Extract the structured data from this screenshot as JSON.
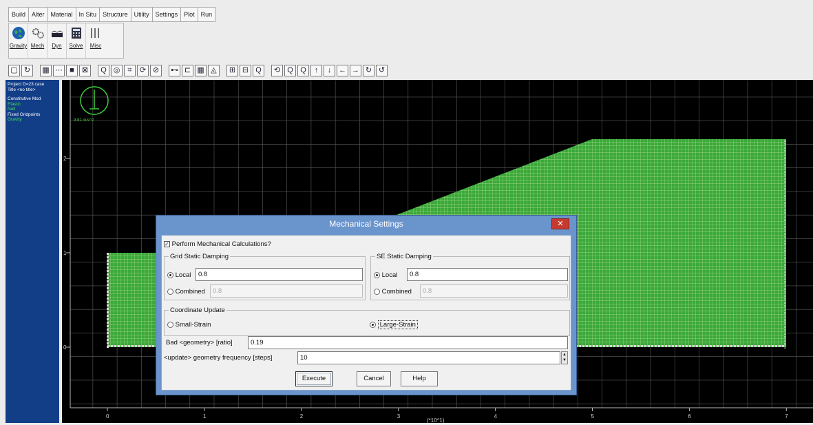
{
  "menu": [
    "Build",
    "Alter",
    "Material",
    "In Situ",
    "Structure",
    "Utility",
    "Settings",
    "Plot",
    "Run"
  ],
  "tools": [
    {
      "label": "Gravity",
      "icon": "globe-icon"
    },
    {
      "label": "Mech",
      "icon": "gears-icon"
    },
    {
      "label": "Dyn",
      "icon": "dynamic-wave-icon"
    },
    {
      "label": "Solve",
      "icon": "calculator-icon"
    },
    {
      "label": "Misc",
      "icon": "misc-bars-icon"
    }
  ],
  "toolbar_icons": [
    "▢",
    "↻",
    "▦",
    "⋯",
    "■",
    "⊠",
    "Q",
    "◎",
    "⌗",
    "⟳",
    "⊘",
    "⊷",
    "⊏",
    "▦",
    "◬",
    "⊞",
    "⊟",
    "Q",
    "⟲",
    "Q",
    "Q",
    "↑",
    "↓",
    "←",
    "→",
    "↻",
    "↺"
  ],
  "info_panel": {
    "lines": [
      "Project D=23 case",
      "Title <no title>"
    ],
    "model_label": "Constitutive Mod",
    "model_status": "Elastic",
    "null_label": "Null",
    "fixed_label": "Fixed Gridpoints",
    "fixed_status": "Gravity"
  },
  "plot": {
    "gravity_label": "9.81 m/s^2",
    "y_ticks": [
      "2",
      "1",
      "0"
    ],
    "x_ticks": [
      "0",
      "1",
      "2",
      "3",
      "4",
      "5",
      "6",
      "7"
    ],
    "xlabel": "(*10^1)",
    "ylabel_marker": "0",
    "colors": {
      "mesh_fill": "#3aa83a",
      "mesh_line": "#93d87c",
      "grid": "#5c5c5c",
      "axes": "#b9b9b9",
      "fixed": "#ffffff"
    }
  },
  "dialog": {
    "title": "Mechanical Settings",
    "close": "✕",
    "perform_label": "Perform Mechanical Calculations?",
    "grid_group": "Grid Static Damping",
    "grid_local_label": "Local",
    "grid_local_value": "0.8",
    "grid_combined_label": "Combined",
    "grid_combined_value": "0.8",
    "se_group": "SE Static Damping",
    "se_local_label": "Local",
    "se_local_value": "0.8",
    "se_combined_label": "Combined",
    "se_combined_value": "0.8",
    "coord_group": "Coordinate Update",
    "small_strain": "Small-Strain",
    "large_strain": "Large-Strain",
    "bad_geometry_label": "Bad <geometry> [ratio]",
    "bad_geometry_value": "0.19",
    "update_freq_label": "<update> geometry frequency [steps]",
    "update_freq_value": "10",
    "execute": "Execute",
    "cancel": "Cancel",
    "help": "Help"
  }
}
